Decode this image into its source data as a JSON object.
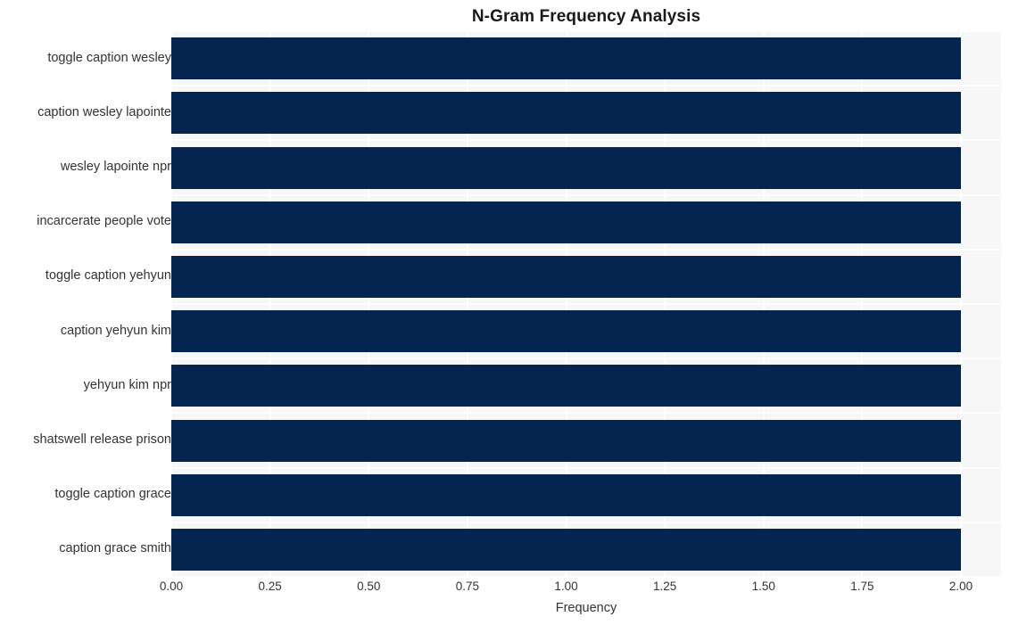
{
  "chart_data": {
    "type": "bar",
    "orientation": "horizontal",
    "title": "N-Gram Frequency Analysis",
    "xlabel": "Frequency",
    "ylabel": "",
    "categories": [
      "toggle caption wesley",
      "caption wesley lapointe",
      "wesley lapointe npr",
      "incarcerate people vote",
      "toggle caption yehyun",
      "caption yehyun kim",
      "yehyun kim npr",
      "shatswell release prison",
      "toggle caption grace",
      "caption grace smith"
    ],
    "values": [
      2,
      2,
      2,
      2,
      2,
      2,
      2,
      2,
      2,
      2
    ],
    "xlim": [
      0.0,
      2.0
    ],
    "xticks": [
      "0.00",
      "0.25",
      "0.50",
      "0.75",
      "1.00",
      "1.25",
      "1.50",
      "1.75",
      "2.00"
    ],
    "xtick_values": [
      0.0,
      0.25,
      0.5,
      0.75,
      1.0,
      1.25,
      1.5,
      1.75,
      2.0
    ],
    "grid": true,
    "legend": null,
    "bar_color": "#04254f",
    "plot_background": "#f7f7f7",
    "grid_color": "#ffffff",
    "figure_background": "#ffffff",
    "text_color": "#333333"
  }
}
